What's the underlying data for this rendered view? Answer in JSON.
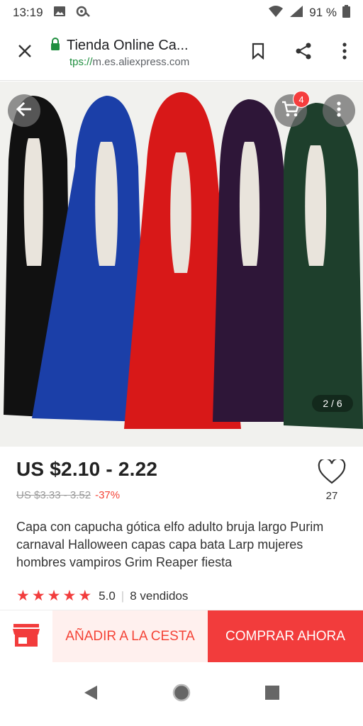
{
  "status_bar": {
    "time": "13:19",
    "battery": "91 %",
    "icons": [
      "image-icon",
      "notification-icon",
      "wifi-icon",
      "signal-icon",
      "battery-icon"
    ]
  },
  "browser": {
    "title": "Tienda Online Ca...",
    "url_scheme": "tps://",
    "url_host": "m.es.aliexpress.com",
    "icons": [
      "close-icon",
      "lock-icon",
      "bookmark-icon",
      "share-icon",
      "more-vert-icon"
    ]
  },
  "gallery": {
    "cart_count": "4",
    "page_indicator": "2 / 6",
    "cape_colors": [
      "#111111",
      "#1b3fa8",
      "#d81818",
      "#2e1638",
      "#1e3f2c"
    ]
  },
  "product": {
    "price": "US $2.10 - 2.22",
    "old_price": "US $3.33 - 3.52",
    "discount": "-37%",
    "wishlist_count": "27",
    "title": "Capa con capucha gótica elfo adulto bruja largo Purim carnaval Halloween capas capa bata Larp mujeres hombres vampiros Grim Reaper fiesta",
    "rating": "5.0",
    "sold": "8 vendidos"
  },
  "actions": {
    "add_to_cart": "AÑADIR A LA CESTA",
    "buy_now": "COMPRAR AHORA"
  },
  "colors": {
    "accent": "#f23c3c",
    "add_cart_bg": "#fff0ee"
  }
}
